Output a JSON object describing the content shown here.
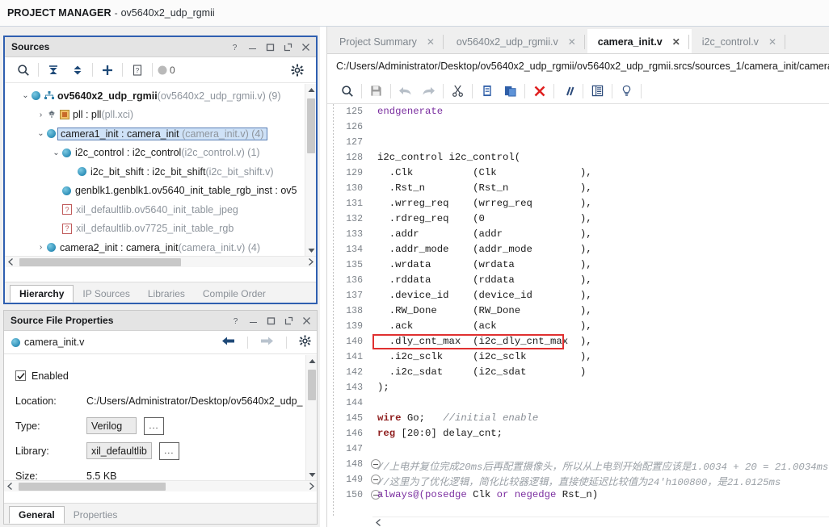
{
  "titlebar": {
    "app": "PROJECT MANAGER",
    "dash": "-",
    "project": "ov5640x2_udp_rgmii"
  },
  "sources": {
    "title": "Sources",
    "head_buttons": [
      "help-icon",
      "minimize-icon",
      "maximize-icon",
      "float-icon",
      "close-icon"
    ],
    "toolbar": {
      "search": "search-icon",
      "collapse_all": "collapse-all-icon",
      "expand_all": "expand-all-icon",
      "add_sources": "plus-icon",
      "report": "report-icon",
      "message_count": "0",
      "settings": "gear-icon"
    },
    "tree": [
      {
        "indent": 0,
        "arrow": "⌄",
        "icon": "circle",
        "extra": "module-icon",
        "label": "ov5640x2_udp_rgmii",
        "dim": "(ov5640x2_udp_rgmii.v) (9)",
        "bold": true,
        "selected": false
      },
      {
        "indent": 1,
        "arrow": "›",
        "icon": "ip",
        "extra": "",
        "label": "pll : pll",
        "dim": "(pll.xci)",
        "bold": false,
        "selected": false
      },
      {
        "indent": 1,
        "arrow": "⌄",
        "icon": "circle",
        "extra": "",
        "label": "camera1_init : camera_init",
        "dim": "(camera_init.v) (4)",
        "bold": false,
        "selected": true
      },
      {
        "indent": 2,
        "arrow": "⌄",
        "icon": "circle",
        "extra": "",
        "label": "i2c_control : i2c_control",
        "dim": "(i2c_control.v) (1)",
        "bold": false,
        "selected": false
      },
      {
        "indent": 3,
        "arrow": "",
        "icon": "circle",
        "extra": "",
        "label": "i2c_bit_shift : i2c_bit_shift",
        "dim": "(i2c_bit_shift.v)",
        "bold": false,
        "selected": false
      },
      {
        "indent": 2,
        "arrow": "",
        "icon": "circle",
        "extra": "",
        "label": "genblk1.genblk1.ov5640_init_table_rgb_inst : ov5",
        "dim": "",
        "bold": false,
        "selected": false
      },
      {
        "indent": 2,
        "arrow": "",
        "icon": "question",
        "extra": "",
        "label": "",
        "dim": "xil_defaultlib.ov5640_init_table_jpeg",
        "bold": false,
        "selected": false
      },
      {
        "indent": 2,
        "arrow": "",
        "icon": "question",
        "extra": "",
        "label": "",
        "dim": "xil_defaultlib.ov7725_init_table_rgb",
        "bold": false,
        "selected": false
      },
      {
        "indent": 1,
        "arrow": "›",
        "icon": "circle",
        "extra": "",
        "label": "camera2_init : camera_init",
        "dim": "(camera_init.v) (4)",
        "bold": false,
        "selected": false
      }
    ],
    "tabs": [
      {
        "label": "Hierarchy",
        "active": true
      },
      {
        "label": "IP Sources",
        "active": false
      },
      {
        "label": "Libraries",
        "active": false
      },
      {
        "label": "Compile Order",
        "active": false
      }
    ]
  },
  "source_file_properties": {
    "title": "Source File Properties",
    "head_buttons": [
      "help-icon",
      "minimize-icon",
      "maximize-icon",
      "float-icon",
      "close-icon"
    ],
    "file_name": "camera_init.v",
    "nav": {
      "back": "back-arrow-icon",
      "forward": "forward-arrow-icon",
      "settings": "gear-icon"
    },
    "enabled_label": "Enabled",
    "enabled_checked": true,
    "fields": [
      {
        "label": "Location:",
        "value": "C:/Users/Administrator/Desktop/ov5640x2_udp_",
        "type": "text"
      },
      {
        "label": "Type:",
        "value": "Verilog",
        "type": "select",
        "browse": "..."
      },
      {
        "label": "Library:",
        "value": "xil_defaultlib",
        "type": "select",
        "browse": "..."
      },
      {
        "label": "Size:",
        "value": "5.5 KB",
        "type": "text"
      }
    ],
    "tabs": [
      {
        "label": "General",
        "active": true
      },
      {
        "label": "Properties",
        "active": false
      }
    ]
  },
  "editor": {
    "tabs": [
      {
        "label": "Project Summary",
        "active": false
      },
      {
        "label": "ov5640x2_udp_rgmii.v",
        "active": false
      },
      {
        "label": "camera_init.v",
        "active": true
      },
      {
        "label": "i2c_control.v",
        "active": false
      }
    ],
    "close_glyph": "✕",
    "path": "C:/Users/Administrator/Desktop/ov5640x2_udp_rgmii/ov5640x2_udp_rgmii.srcs/sources_1/camera_init/camera",
    "toolbar": [
      "search-icon",
      "save-icon",
      "undo-icon",
      "redo-icon",
      "cut-icon",
      "copy-icon",
      "paste-icon",
      "delete-icon",
      "comment-icon",
      "indent-icon",
      "bulb-icon"
    ],
    "highlight_color": "#e03030",
    "code": [
      {
        "num": "125",
        "fold": "",
        "tokens": [
          {
            "t": "endgenerate",
            "c": "kw"
          }
        ]
      },
      {
        "num": "126",
        "fold": "",
        "tokens": []
      },
      {
        "num": "127",
        "fold": "",
        "tokens": []
      },
      {
        "num": "128",
        "fold": "",
        "tokens": [
          {
            "t": "i2c_control i2c_control(",
            "c": ""
          }
        ]
      },
      {
        "num": "129",
        "fold": "",
        "tokens": [
          {
            "t": "  .Clk          (Clk              ),",
            "c": ""
          }
        ]
      },
      {
        "num": "130",
        "fold": "",
        "tokens": [
          {
            "t": "  .Rst_n        (Rst_n            ),",
            "c": ""
          }
        ]
      },
      {
        "num": "131",
        "fold": "",
        "tokens": [
          {
            "t": "  .wrreg_req    (wrreg_req        ),",
            "c": ""
          }
        ]
      },
      {
        "num": "132",
        "fold": "",
        "tokens": [
          {
            "t": "  .rdreg_req    (0                ),",
            "c": ""
          }
        ]
      },
      {
        "num": "133",
        "fold": "",
        "tokens": [
          {
            "t": "  .addr         (addr             ),",
            "c": ""
          }
        ]
      },
      {
        "num": "134",
        "fold": "",
        "tokens": [
          {
            "t": "  .addr_mode    (addr_mode        ),",
            "c": ""
          }
        ]
      },
      {
        "num": "135",
        "fold": "",
        "tokens": [
          {
            "t": "  .wrdata       (wrdata           ),",
            "c": ""
          }
        ]
      },
      {
        "num": "136",
        "fold": "",
        "tokens": [
          {
            "t": "  .rddata       (rddata           ),",
            "c": ""
          }
        ]
      },
      {
        "num": "137",
        "fold": "",
        "tokens": [
          {
            "t": "  .device_id    (device_id        ),",
            "c": ""
          }
        ]
      },
      {
        "num": "138",
        "fold": "",
        "tokens": [
          {
            "t": "  .RW_Done      (RW_Done          ),",
            "c": ""
          }
        ]
      },
      {
        "num": "139",
        "fold": "",
        "tokens": [
          {
            "t": "  .ack          (ack              ),",
            "c": ""
          }
        ]
      },
      {
        "num": "140",
        "fold": "",
        "highlight": true,
        "tokens": [
          {
            "t": "  .dly_cnt_max  (i2c_dly_cnt_max  ),",
            "c": ""
          }
        ]
      },
      {
        "num": "141",
        "fold": "",
        "tokens": [
          {
            "t": "  .i2c_sclk     (i2c_sclk         ),",
            "c": ""
          }
        ]
      },
      {
        "num": "142",
        "fold": "",
        "tokens": [
          {
            "t": "  .i2c_sdat     (i2c_sdat         )",
            "c": ""
          }
        ]
      },
      {
        "num": "143",
        "fold": "",
        "tokens": [
          {
            "t": ");",
            "c": ""
          }
        ]
      },
      {
        "num": "144",
        "fold": "",
        "tokens": []
      },
      {
        "num": "145",
        "fold": "",
        "tokens": [
          {
            "t": "wire",
            "c": "kw2"
          },
          {
            "t": " Go;   ",
            "c": ""
          },
          {
            "t": "//initial enable",
            "c": "cmt"
          }
        ]
      },
      {
        "num": "146",
        "fold": "",
        "tokens": [
          {
            "t": "reg",
            "c": "kw2"
          },
          {
            "t": " [20:0] delay_cnt;",
            "c": ""
          }
        ]
      },
      {
        "num": "147",
        "fold": "",
        "tokens": []
      },
      {
        "num": "148",
        "fold": "minus",
        "tokens": [
          {
            "t": "//上电并复位完成20ms后再配置摄像头，所以从上电到开始配置应该是1.0034 + 20 = 21.0034ms",
            "c": "cmt2"
          }
        ]
      },
      {
        "num": "149",
        "fold": "minus",
        "tokens": [
          {
            "t": "//这里为了优化逻辑，简化比较器逻辑，直接使延迟比较值为24'h100800，是21.0125ms",
            "c": "cmt2"
          }
        ]
      },
      {
        "num": "150",
        "fold": "minus",
        "tokens": [
          {
            "t": "always@(",
            "c": "kw"
          },
          {
            "t": "posedge",
            "c": "kw"
          },
          {
            "t": " Clk ",
            "c": ""
          },
          {
            "t": "or",
            "c": "kw"
          },
          {
            "t": " ",
            "c": ""
          },
          {
            "t": "negedge",
            "c": "kw"
          },
          {
            "t": " Rst_n)",
            "c": ""
          }
        ]
      }
    ]
  }
}
